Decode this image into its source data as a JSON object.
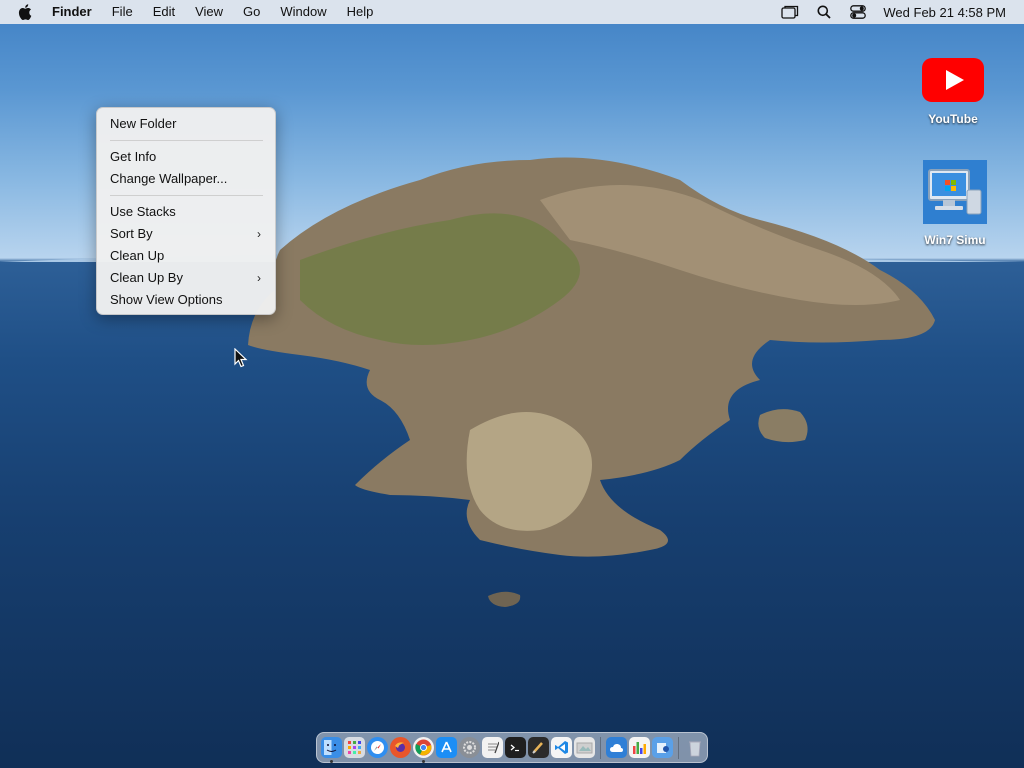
{
  "menubar": {
    "apple_icon": "apple-icon",
    "app_name": "Finder",
    "menus": [
      "File",
      "Edit",
      "View",
      "Go",
      "Window",
      "Help"
    ],
    "status_icons": [
      "screen-mirroring-icon",
      "search-icon",
      "control-center-icon"
    ],
    "clock": "Wed Feb 21  4:58 PM"
  },
  "context_menu": {
    "groups": [
      [
        {
          "label": "New Folder",
          "submenu": false
        }
      ],
      [
        {
          "label": "Get Info",
          "submenu": false
        },
        {
          "label": "Change Wallpaper...",
          "submenu": false
        }
      ],
      [
        {
          "label": "Use Stacks",
          "submenu": false
        },
        {
          "label": "Sort By",
          "submenu": true
        },
        {
          "label": "Clean Up",
          "submenu": false
        },
        {
          "label": "Clean Up By",
          "submenu": true
        },
        {
          "label": "Show View Options",
          "submenu": false
        }
      ]
    ],
    "submenu_arrow": "›"
  },
  "desktop_icons": [
    {
      "label": "YouTube",
      "icon": "youtube-icon"
    },
    {
      "label": "Win7 Simu",
      "icon": "win7-simulator-icon"
    }
  ],
  "dock": {
    "apps": [
      {
        "icon": "finder-icon",
        "color": "#3a8ee6",
        "running": true
      },
      {
        "icon": "launchpad-icon",
        "color": "#d8dce2",
        "running": false
      },
      {
        "icon": "safari-icon",
        "color": "#2f8ef0",
        "running": false
      },
      {
        "icon": "firefox-icon",
        "color": "#e8562a",
        "running": false
      },
      {
        "icon": "chrome-icon",
        "color": "#f1f1f1",
        "running": true
      },
      {
        "icon": "app-store-icon",
        "color": "#1c8ef5",
        "running": false
      },
      {
        "icon": "system-settings-icon",
        "color": "#8a8f96",
        "running": false
      },
      {
        "icon": "textedit-icon",
        "color": "#f2f2f2",
        "running": false
      },
      {
        "icon": "terminal-icon",
        "color": "#1f1f1f",
        "running": false
      },
      {
        "icon": "script-editor-icon",
        "color": "#2b2b2b",
        "running": false
      },
      {
        "icon": "vscode-icon",
        "color": "#f5f5f5",
        "running": false
      },
      {
        "icon": "preview-icon",
        "color": "#e6e6e6",
        "running": false
      },
      {
        "icon": "weather-icon",
        "color": "#2f7fd6",
        "running": false
      },
      {
        "icon": "activity-monitor-icon",
        "color": "#f4f4f4",
        "running": false
      },
      {
        "icon": "folder-icon",
        "color": "#5aa0e8",
        "running": false
      }
    ],
    "trash_icon": "trash-icon"
  },
  "colors": {
    "youtube_red": "#ff0000",
    "menu_bg": "#f0f0f0"
  }
}
